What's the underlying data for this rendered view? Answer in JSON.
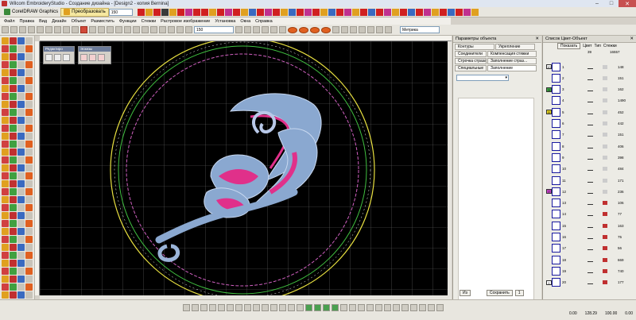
{
  "window": {
    "title": "Wilcom EmbroideryStudio - Создание дизайна - [Design2 - копия      Bernina]"
  },
  "toolbar1": {
    "corel_label": "CorelDRAW Graphics",
    "convert_label": "Преобразовать",
    "zoom_value": "150"
  },
  "menu": {
    "items": [
      "Файл",
      "Правка",
      "Вид",
      "Дизайн",
      "Объект",
      "Разместить",
      "Функции",
      "Стежки",
      "Растровое изображение",
      "Установка",
      "Окна",
      "Справка"
    ]
  },
  "toolbar2": {
    "zoom_value": "150",
    "units_value": "Метрика"
  },
  "floaters": {
    "editor_title": "Редактиро",
    "sketch_title": "Эскизы"
  },
  "props": {
    "title": "Параметры объекта",
    "tabs": [
      "Контуры",
      "Укрепление",
      "Соединители",
      "Компенсация стяжки",
      "Строчка страза...",
      "Заполнение страз...",
      "Специальные",
      "Заполнение"
    ],
    "save_label": "Сохранить",
    "footer_left": "Из",
    "footer_right": "1"
  },
  "colist": {
    "title": "Список Цвет-Объект",
    "show_label": "Показать",
    "header_color": "Цвет",
    "header_type": "Тип",
    "header_stitches": "Стежки",
    "total_top": "39",
    "total_stitches": "16557",
    "rows": [
      {
        "num": "1",
        "stitches": "148"
      },
      {
        "num": "2",
        "stitches": "151"
      },
      {
        "num": "3",
        "stitches": "162"
      },
      {
        "num": "4",
        "stitches": "1490"
      },
      {
        "num": "5",
        "stitches": "452"
      },
      {
        "num": "6",
        "stitches": "442"
      },
      {
        "num": "7",
        "stitches": "151"
      },
      {
        "num": "8",
        "stitches": "406"
      },
      {
        "num": "9",
        "stitches": "398"
      },
      {
        "num": "10",
        "stitches": "484"
      },
      {
        "num": "11",
        "stitches": "171"
      },
      {
        "num": "12",
        "stitches": "236"
      },
      {
        "num": "13",
        "stitches": "106"
      },
      {
        "num": "14",
        "stitches": "77"
      },
      {
        "num": "15",
        "stitches": "163"
      },
      {
        "num": "16",
        "stitches": "75"
      },
      {
        "num": "17",
        "stitches": "56"
      },
      {
        "num": "18",
        "stitches": "669"
      },
      {
        "num": "19",
        "stitches": "740"
      },
      {
        "num": "20",
        "stitches": "177"
      }
    ],
    "color_badges": [
      "10",
      "3",
      "5",
      "7",
      "1"
    ]
  },
  "status": {
    "val1": "0.00",
    "val2": "128.29",
    "val3": "100.00",
    "val4": "0.00"
  },
  "colors": {
    "canvas_bg": "#000000",
    "yellow_hoop": "#e8e040",
    "green_hoop": "#40c040",
    "pink_hoop": "#d060c0",
    "design_blue": "#8aa8d0",
    "design_pink": "#e0308a"
  }
}
